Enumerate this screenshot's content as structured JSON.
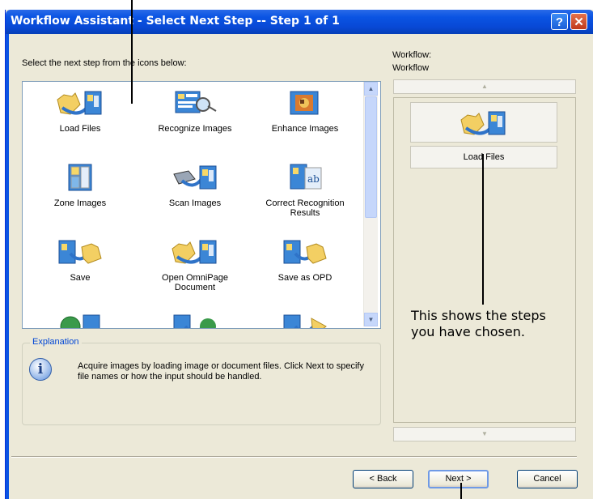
{
  "window": {
    "title": "Workflow Assistant - Select Next Step -- Step 1 of 1",
    "help_glyph": "?",
    "close_glyph": "✕"
  },
  "steps_panel": {
    "instruction": "Select the next step from the icons below:",
    "items": [
      {
        "label": "Load Files",
        "icon": "load-files-icon"
      },
      {
        "label": "Recognize Images",
        "icon": "recognize-images-icon"
      },
      {
        "label": "Enhance Images",
        "icon": "enhance-images-icon"
      },
      {
        "label": "Zone Images",
        "icon": "zone-images-icon"
      },
      {
        "label": "Scan Images",
        "icon": "scan-images-icon"
      },
      {
        "label": "Correct Recognition Results",
        "icon": "correct-recognition-icon"
      },
      {
        "label": "Save",
        "icon": "save-icon"
      },
      {
        "label": "Open OmniPage Document",
        "icon": "open-omnipage-icon"
      },
      {
        "label": "Save as OPD",
        "icon": "save-as-opd-icon"
      }
    ]
  },
  "explanation": {
    "legend": "Explanation",
    "text": "Acquire images by loading image or document files. Click Next to specify file names or how the input should be handled."
  },
  "workflow_panel": {
    "label_line1": "Workflow:",
    "label_line2": "Workflow",
    "steps": [
      {
        "label": "Load Files",
        "icon": "load-files-icon"
      }
    ]
  },
  "buttons": {
    "back": "< Back",
    "next": "Next >",
    "cancel": "Cancel"
  },
  "annotation": {
    "line1": "This shows the steps",
    "line2": "you have chosen."
  },
  "colors": {
    "titlebar": "#0a54e3",
    "dialog_bg": "#ece9d8",
    "explanation_legend": "#0046d5"
  }
}
